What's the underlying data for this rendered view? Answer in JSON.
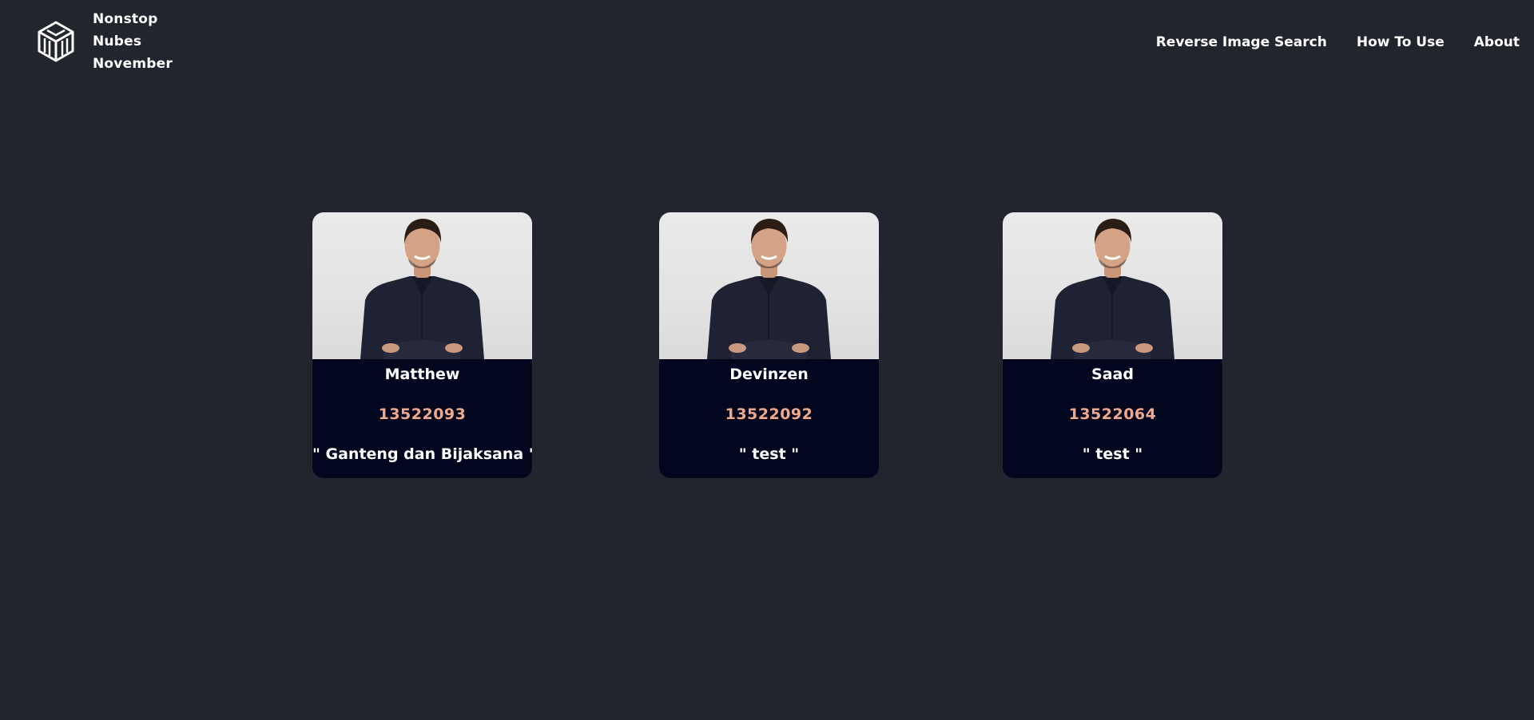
{
  "header": {
    "brand_lines": [
      "Nonstop",
      "Nubes",
      "November"
    ],
    "logo_icon": "cube-logo-icon",
    "nav": [
      {
        "label": "Reverse Image Search"
      },
      {
        "label": "How To Use"
      },
      {
        "label": "About"
      }
    ]
  },
  "cards": [
    {
      "name": "Matthew",
      "id": "13522093",
      "quote": "\" Ganteng dan Bijaksana \"",
      "photo_icon": "person-photo"
    },
    {
      "name": "Devinzen",
      "id": "13522092",
      "quote": "\" test \"",
      "photo_icon": "person-photo"
    },
    {
      "name": "Saad",
      "id": "13522064",
      "quote": "\" test \"",
      "photo_icon": "person-photo"
    }
  ],
  "colors": {
    "background": "#22252e",
    "card_background": "#03061f",
    "id_accent": "#f0a98a",
    "text": "#ffffff"
  }
}
